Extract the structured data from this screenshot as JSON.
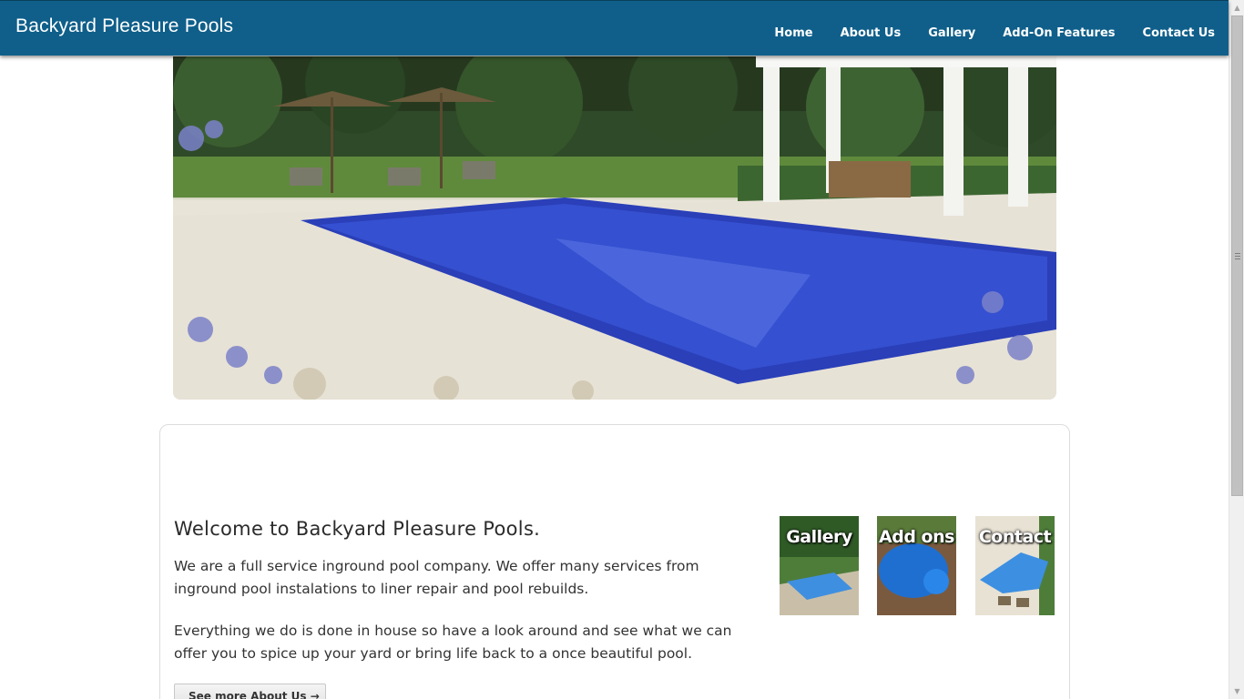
{
  "header": {
    "brand": "Backyard Pleasure Pools",
    "nav": [
      "Home",
      "About Us",
      "Gallery",
      "Add-On Features",
      "Contact Us"
    ]
  },
  "hero": {
    "icon": "pool-photo"
  },
  "main": {
    "welcome_title": "Welcome to Backyard Pleasure Pools.",
    "paragraph1": "We are a full service inground pool company. We offer many services from inground pool instalations to liner repair and pool rebuilds.",
    "paragraph2": "Everything we do is done in house so have a look around and see what we can offer you to spice up your yard or bring life back to a once beautiful pool.",
    "more_button": "See more About Us →"
  },
  "thumbnails": [
    {
      "caption": "Gallery"
    },
    {
      "caption": "Add ons"
    },
    {
      "caption": "Contact"
    }
  ],
  "colors": {
    "header": "#0f5f8a",
    "pool": "#2a3fb8"
  }
}
